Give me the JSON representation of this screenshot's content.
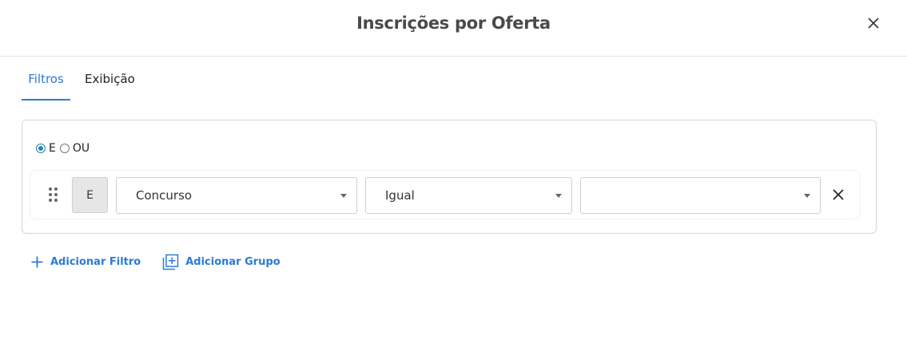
{
  "dialog": {
    "title": "Inscrições por Oferta"
  },
  "tabs": [
    {
      "label": "Filtros",
      "active": true
    },
    {
      "label": "Exibição",
      "active": false
    }
  ],
  "logic": {
    "options": [
      {
        "label": "E",
        "checked": true
      },
      {
        "label": "OU",
        "checked": false
      }
    ]
  },
  "filter_row": {
    "connector": "E",
    "field": "Concurso",
    "operator": "Igual",
    "value": ""
  },
  "actions": {
    "add_filter": "Adicionar Filtro",
    "add_group": "Adicionar Grupo"
  },
  "colors": {
    "accent": "#2b7bd6",
    "radio": "#2a82b0"
  }
}
